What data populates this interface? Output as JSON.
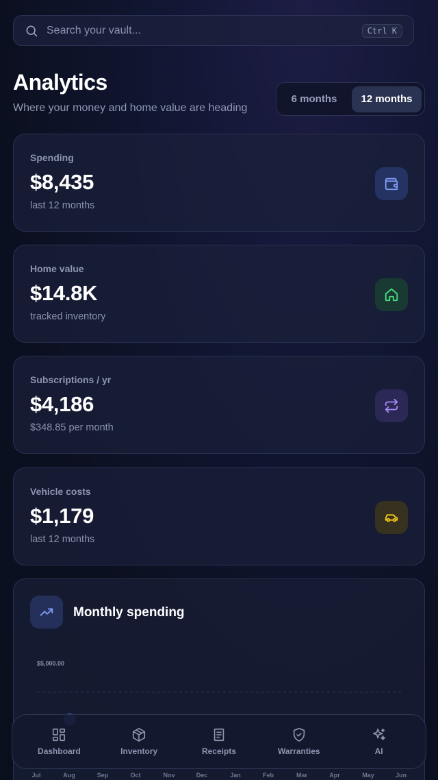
{
  "search": {
    "placeholder": "Search your vault...",
    "shortcut": "Ctrl K"
  },
  "header": {
    "title": "Analytics",
    "subtitle": "Where your money and home value are heading",
    "ranges": [
      "6 months",
      "12 months"
    ],
    "active_range": "12 months"
  },
  "cards": [
    {
      "label": "Spending",
      "value": "$8,435",
      "sub": "last 12 months",
      "icon": "wallet-icon",
      "color": "#7f9cf5",
      "bg": "#243362"
    },
    {
      "label": "Home value",
      "value": "$14.8K",
      "sub": "tracked inventory",
      "icon": "home-icon",
      "color": "#4ade80",
      "bg": "#183a33"
    },
    {
      "label": "Subscriptions / yr",
      "value": "$4,186",
      "sub": "$348.85 per month",
      "icon": "repeat-icon",
      "color": "#a78bfa",
      "bg": "#2c2856"
    },
    {
      "label": "Vehicle costs",
      "value": "$1,179",
      "sub": "last 12 months",
      "icon": "car-icon",
      "color": "#facc15",
      "bg": "#36321f"
    }
  ],
  "chart": {
    "title": "Monthly spending",
    "icon": "trending-up-icon"
  },
  "chart_data": {
    "type": "line",
    "title": "Monthly spending",
    "categories": [
      "Jul",
      "Aug",
      "Sep",
      "Oct",
      "Nov",
      "Dec",
      "Jan",
      "Feb",
      "Mar",
      "Apr",
      "May",
      "Jun"
    ],
    "y_tick_labels": [
      "$5,000.00"
    ],
    "grid": true
  },
  "nav": [
    {
      "label": "Dashboard",
      "icon": "dashboard-icon"
    },
    {
      "label": "Inventory",
      "icon": "package-icon"
    },
    {
      "label": "Receipts",
      "icon": "receipt-icon"
    },
    {
      "label": "Warranties",
      "icon": "shield-check-icon"
    },
    {
      "label": "AI",
      "icon": "sparkles-icon"
    }
  ],
  "colors": {
    "accent": "#3b6fd9",
    "background": "#0b1020",
    "card": "#1b203a"
  }
}
